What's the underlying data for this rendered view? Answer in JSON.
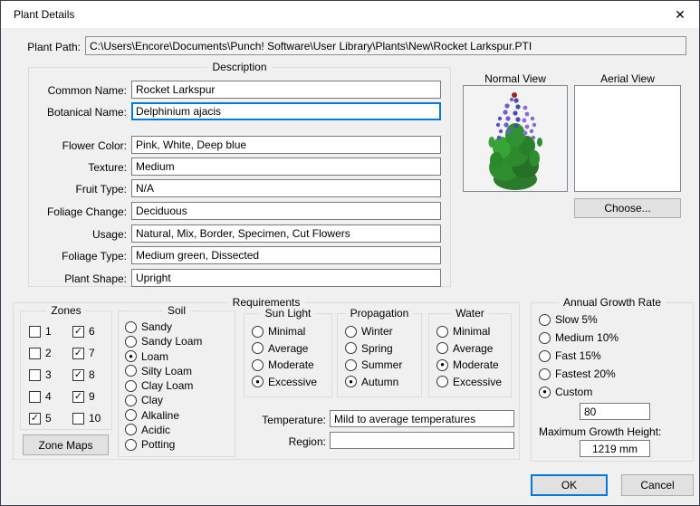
{
  "window": {
    "title": "Plant Details",
    "close_glyph": "✕"
  },
  "plant_path": {
    "label": "Plant Path:",
    "value": "C:\\Users\\Encore\\Documents\\Punch! Software\\User Library\\Plants\\New\\Rocket Larkspur.PTI"
  },
  "description": {
    "title": "Description",
    "fields": [
      {
        "label": "Common Name:",
        "value": "Rocket Larkspur"
      },
      {
        "label": "Botanical Name:",
        "value": "Delphinium ajacis"
      },
      {
        "label": "Flower Color:",
        "value": "Pink, White, Deep blue"
      },
      {
        "label": "Texture:",
        "value": "Medium"
      },
      {
        "label": "Fruit Type:",
        "value": "N/A"
      },
      {
        "label": "Foliage Change:",
        "value": "Deciduous"
      },
      {
        "label": "Usage:",
        "value": "Natural, Mix, Border, Specimen, Cut Flowers"
      },
      {
        "label": "Foliage Type:",
        "value": "Medium green, Dissected"
      },
      {
        "label": "Plant Shape:",
        "value": "Upright"
      }
    ]
  },
  "views": {
    "normal_label": "Normal View",
    "aerial_label": "Aerial View",
    "choose_button": "Choose..."
  },
  "requirements": {
    "title": "Requirements",
    "zones": {
      "title": "Zones",
      "cells": [
        {
          "n": "1",
          "mark": ""
        },
        {
          "n": "6",
          "mark": "✓"
        },
        {
          "n": "2",
          "mark": ""
        },
        {
          "n": "7",
          "mark": "✓"
        },
        {
          "n": "3",
          "mark": ""
        },
        {
          "n": "8",
          "mark": "✓"
        },
        {
          "n": "4",
          "mark": ""
        },
        {
          "n": "9",
          "mark": "✓"
        },
        {
          "n": "5",
          "mark": "✓"
        },
        {
          "n": "10",
          "mark": ""
        }
      ],
      "button": "Zone Maps"
    },
    "soil": {
      "title": "Soil",
      "options": [
        {
          "label": "Sandy",
          "mark": ""
        },
        {
          "label": "Sandy Loam",
          "mark": ""
        },
        {
          "label": "Loam",
          "mark": "●"
        },
        {
          "label": "Silty Loam",
          "mark": ""
        },
        {
          "label": "Clay Loam",
          "mark": ""
        },
        {
          "label": "Clay",
          "mark": ""
        },
        {
          "label": "Alkaline",
          "mark": ""
        },
        {
          "label": "Acidic",
          "mark": ""
        },
        {
          "label": "Potting",
          "mark": ""
        }
      ]
    },
    "sun_light": {
      "title": "Sun Light",
      "options": [
        {
          "label": "Minimal",
          "mark": ""
        },
        {
          "label": "Average",
          "mark": ""
        },
        {
          "label": "Moderate",
          "mark": ""
        },
        {
          "label": "Excessive",
          "mark": "●"
        }
      ]
    },
    "propagation": {
      "title": "Propagation",
      "options": [
        {
          "label": "Winter",
          "mark": ""
        },
        {
          "label": "Spring",
          "mark": ""
        },
        {
          "label": "Summer",
          "mark": ""
        },
        {
          "label": "Autumn",
          "mark": "●"
        }
      ]
    },
    "water": {
      "title": "Water",
      "options": [
        {
          "label": "Minimal",
          "mark": ""
        },
        {
          "label": "Average",
          "mark": ""
        },
        {
          "label": "Moderate",
          "mark": "●"
        },
        {
          "label": "Excessive",
          "mark": ""
        }
      ]
    },
    "temperature": {
      "label": "Temperature:",
      "value": "Mild to average temperatures"
    },
    "region": {
      "label": "Region:",
      "value": ""
    }
  },
  "growth": {
    "title": "Annual Growth Rate",
    "options": [
      {
        "label": "Slow 5%",
        "mark": ""
      },
      {
        "label": "Medium 10%",
        "mark": ""
      },
      {
        "label": "Fast 15%",
        "mark": ""
      },
      {
        "label": "Fastest 20%",
        "mark": ""
      },
      {
        "label": "Custom",
        "mark": "●"
      }
    ],
    "custom_value": "80",
    "max_height_label": "Maximum Growth Height:",
    "max_height_value": "1219 mm"
  },
  "footer": {
    "ok": "OK",
    "cancel": "Cancel"
  },
  "colors": {
    "accent": "#0078d7",
    "dialog_bg": "#f0f0f0"
  }
}
